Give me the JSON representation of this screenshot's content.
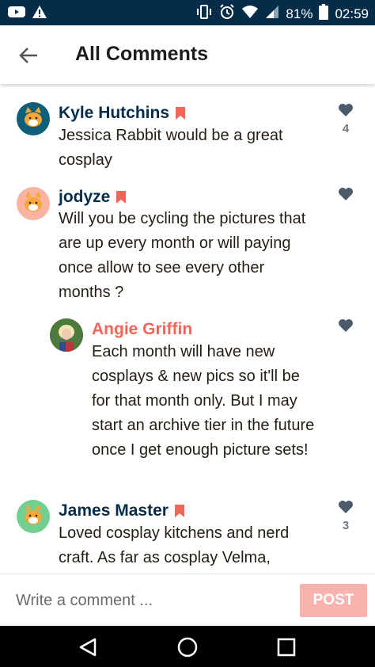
{
  "status_bar": {
    "icons_left": [
      "youtube-icon",
      "warning-icon"
    ],
    "icons_right": [
      "vibrate-icon",
      "alarm-icon",
      "wifi-icon",
      "signal-icon"
    ],
    "battery_percent": "81%",
    "time": "02:59"
  },
  "header": {
    "title": "All Comments"
  },
  "comments": [
    {
      "author": "Kyle Hutchins",
      "is_patron": true,
      "text": "Jessica Rabbit would be a great cosplay",
      "likes": "4"
    },
    {
      "author": "jodyze",
      "is_patron": true,
      "text": "Will you be cycling the pictures that are up every month or will paying once allow to see every other months ?",
      "likes": ""
    },
    {
      "author": "Angie Griffin",
      "is_creator": true,
      "text": "Each month will have new cosplays & new pics so it'll be for that month only. But I may start an archive tier in the future once I get enough picture sets!",
      "likes": ""
    },
    {
      "author": "James Master",
      "is_patron": true,
      "text": "Loved cosplay kitchens and nerd craft. As far as cosplay Velma,",
      "likes": "3"
    }
  ],
  "comment_box": {
    "placeholder": "Write a comment ...",
    "post_label": "POST"
  },
  "colors": {
    "status_bar": "#052d49",
    "author": "#052d49",
    "creator": "#f1655b",
    "post_button": "#f9b3ae"
  }
}
